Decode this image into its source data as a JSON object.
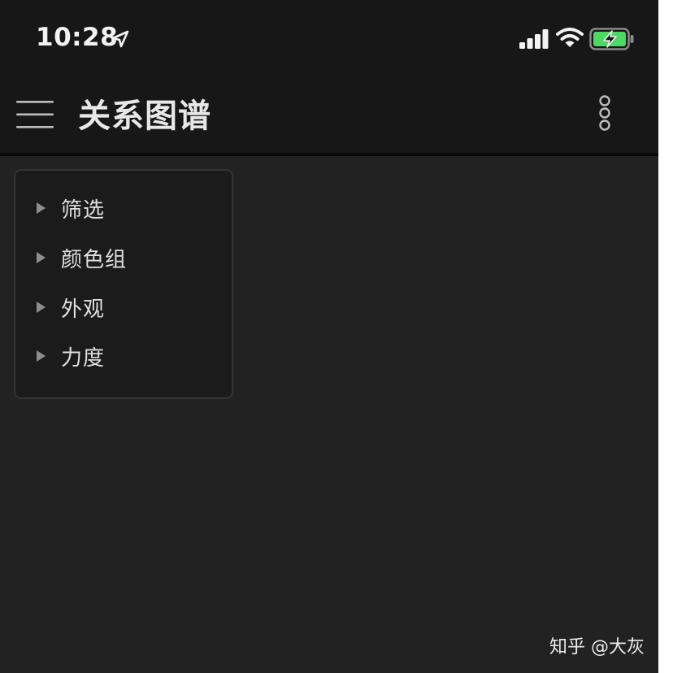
{
  "status_bar": {
    "time": "10:28",
    "location_icon": "location-arrow-icon",
    "signal_icon": "cellular-signal-icon",
    "wifi_icon": "wifi-icon",
    "battery_icon": "battery-charging-icon",
    "battery_color": "#4cd964"
  },
  "app_bar": {
    "menu_icon": "hamburger-menu-icon",
    "title": "关系图谱",
    "more_icon": "more-vertical-icon"
  },
  "settings_panel": {
    "items": [
      {
        "label": "筛选",
        "expanded": false
      },
      {
        "label": "颜色组",
        "expanded": false
      },
      {
        "label": "外观",
        "expanded": false
      },
      {
        "label": "力度",
        "expanded": false
      }
    ]
  },
  "watermark": {
    "text": "知乎 @大灰"
  },
  "colors": {
    "background": "#222222",
    "bar": "#171717",
    "text": "#e0e0e0"
  }
}
